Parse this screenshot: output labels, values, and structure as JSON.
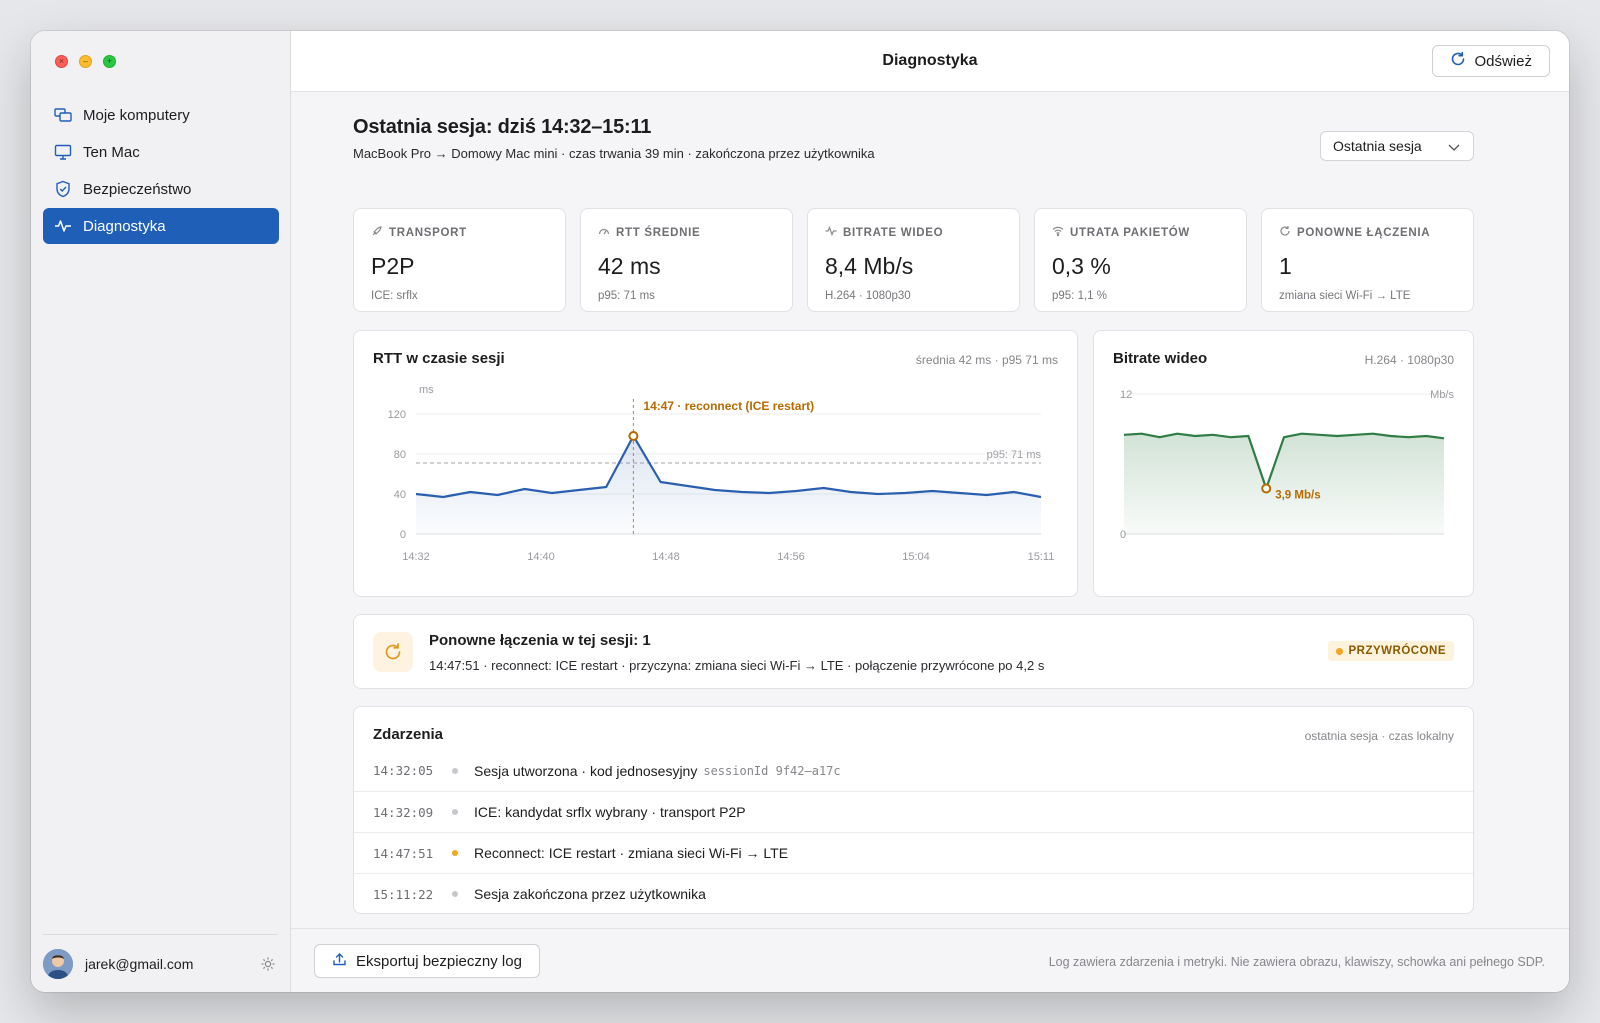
{
  "window": {
    "title": "Diagnostyka"
  },
  "sidebar": {
    "items": [
      {
        "label": "Moje komputery",
        "icon": "computers-icon",
        "active": false
      },
      {
        "label": "Ten Mac",
        "icon": "monitor-icon",
        "active": false
      },
      {
        "label": "Bezpieczeństwo",
        "icon": "shield-icon",
        "active": false
      },
      {
        "label": "Diagnostyka",
        "icon": "pulse-icon",
        "active": true
      }
    ],
    "user": {
      "email": "jarek@gmail.com"
    }
  },
  "toolbar": {
    "refresh_label": "Odśwież"
  },
  "session": {
    "title": "Ostatnia sesja: dziś 14:32–15:11",
    "subtitle": "MacBook Pro → Domowy Mac mini · czas trwania 39 min · zakończona przez użytkownika",
    "selector": "Ostatnia sesja"
  },
  "metrics": [
    {
      "label": "TRANSPORT",
      "icon": "link-icon",
      "value": "P2P",
      "sub": "ICE: srflx"
    },
    {
      "label": "RTT ŚREDNIE",
      "icon": "gauge-icon",
      "value": "42 ms",
      "sub": "p95: 71 ms"
    },
    {
      "label": "BITRATE WIDEO",
      "icon": "activity-icon",
      "value": "8,4 Mb/s",
      "sub": "H.264 · 1080p30"
    },
    {
      "label": "UTRATA PAKIETÓW",
      "icon": "wifi-icon",
      "value": "0,3 %",
      "sub": "p95: 1,1 %"
    },
    {
      "label": "PONOWNE ŁĄCZENIA",
      "icon": "reconnect-icon",
      "value": "1",
      "sub": "zmiana sieci Wi-Fi → LTE"
    }
  ],
  "rtt_panel": {
    "title": "RTT w czasie sesji",
    "meta": "średnia 42 ms · p95 71 ms"
  },
  "bitrate_panel": {
    "title": "Bitrate wideo",
    "meta": "H.264 · 1080p30"
  },
  "chart_data": [
    {
      "type": "line",
      "title": "RTT w czasie sesji",
      "ylabel": "ms",
      "ylim": [
        0,
        120
      ],
      "yticks": [
        "0",
        "40",
        "80",
        "120"
      ],
      "xticks": [
        "14:32",
        "14:40",
        "14:48",
        "14:56",
        "15:04",
        "15:11"
      ],
      "grid": true,
      "series": [
        {
          "values": [
            40,
            37,
            42,
            39,
            45,
            41,
            44,
            47,
            98,
            52,
            48,
            44,
            42,
            41,
            43,
            46,
            42,
            40,
            41,
            43,
            41,
            39,
            42,
            37
          ]
        }
      ],
      "reference_line": {
        "label": "p95: 71 ms",
        "value": 71
      },
      "annotation": {
        "label": "14:47 · reconnect (ICE restart)",
        "point_index": 8
      }
    },
    {
      "type": "area",
      "title": "Bitrate wideo",
      "ylabel": "Mb/s",
      "ylim": [
        0,
        12
      ],
      "yticks": [
        "0",
        "12"
      ],
      "grid": true,
      "series": [
        {
          "values": [
            8.5,
            8.6,
            8.3,
            8.6,
            8.4,
            8.5,
            8.3,
            8.4,
            3.9,
            8.3,
            8.6,
            8.5,
            8.4,
            8.5,
            8.6,
            8.4,
            8.3,
            8.4,
            8.2
          ]
        }
      ],
      "annotation": {
        "label": "3,9 Mb/s",
        "point_index": 8
      }
    }
  ],
  "reconnect": {
    "title": "Ponowne łączenia w tej sesji: 1",
    "detail": "14:47:51 · reconnect: ICE restart · przyczyna: zmiana sieci Wi-Fi → LTE · połączenie przywrócone po 4,2 s",
    "badge": "PRZYWRÓCONE",
    "badge_color": "#f5a623"
  },
  "events": {
    "title": "Zdarzenia",
    "meta": "ostatnia sesja · czas lokalny",
    "rows": [
      {
        "time": "14:32:05",
        "text": "Sesja utworzona · kod jednosesyjny",
        "code": "sessionId 9f42–a17c",
        "level": "info"
      },
      {
        "time": "14:32:09",
        "text": "ICE: kandydat srflx wybrany · transport P2P",
        "code": "",
        "level": "info"
      },
      {
        "time": "14:47:51",
        "text": "Reconnect: ICE restart · zmiana sieci Wi-Fi → LTE",
        "code": "",
        "level": "warn"
      },
      {
        "time": "15:11:22",
        "text": "Sesja zakończona przez użytkownika",
        "code": "",
        "level": "info"
      }
    ]
  },
  "footer": {
    "export_label": "Eksportuj bezpieczny log",
    "note": "Log zawiera zdarzenia i metryki. Nie zawiera obrazu, klawiszy, schowka ani pełnego SDP."
  },
  "colors": {
    "accent": "#1f5fb8",
    "rtt_line": "#2a5fb0",
    "bitrate_line": "#2f7d45",
    "warning": "#f5a623",
    "annotation": "#b86a00"
  }
}
